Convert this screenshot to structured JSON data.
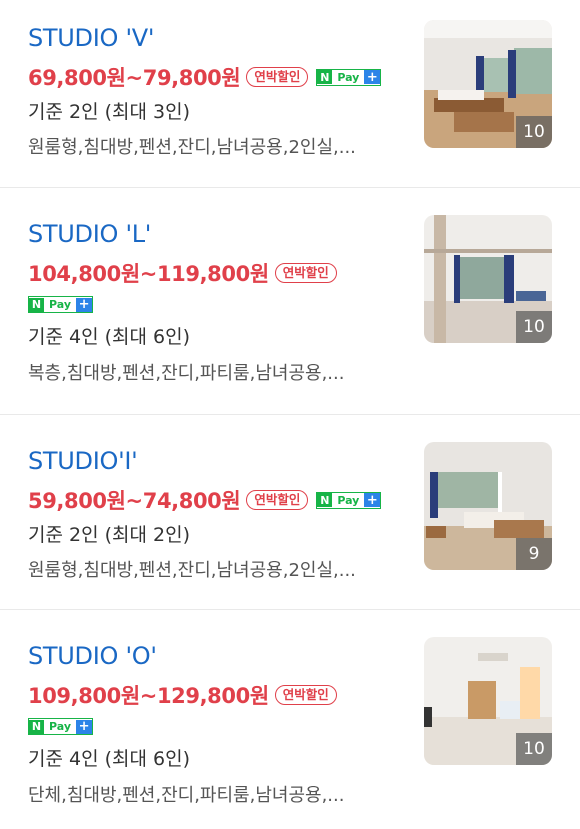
{
  "rooms": [
    {
      "title": "STUDIO 'V'",
      "price": "69,800원~79,800원",
      "badge": "연박할인",
      "npay": {
        "n": "N",
        "pay": "Pay",
        "plus": "+"
      },
      "capacity": "기준 2인 (최대 3인)",
      "tags": "원룸형,침대방,펜션,잔디,남녀공용,2인실,...",
      "photo_count": "10"
    },
    {
      "title": "STUDIO 'L'",
      "price": "104,800원~119,800원",
      "badge": "연박할인",
      "npay": {
        "n": "N",
        "pay": "Pay",
        "plus": "+"
      },
      "capacity": "기준 4인 (최대 6인)",
      "tags": "복층,침대방,펜션,잔디,파티룸,남녀공용,...",
      "photo_count": "10"
    },
    {
      "title": "STUDIO'I'",
      "price": "59,800원~74,800원",
      "badge": "연박할인",
      "npay": {
        "n": "N",
        "pay": "Pay",
        "plus": "+"
      },
      "capacity": "기준 2인 (최대 2인)",
      "tags": "원룸형,침대방,펜션,잔디,남녀공용,2인실,...",
      "photo_count": "9"
    },
    {
      "title": "STUDIO 'O'",
      "price": "109,800원~129,800원",
      "badge": "연박할인",
      "npay": {
        "n": "N",
        "pay": "Pay",
        "plus": "+"
      },
      "capacity": "기준 4인 (최대 6인)",
      "tags": "단체,침대방,펜션,잔디,파티룸,남녀공용,...",
      "photo_count": "10"
    }
  ]
}
